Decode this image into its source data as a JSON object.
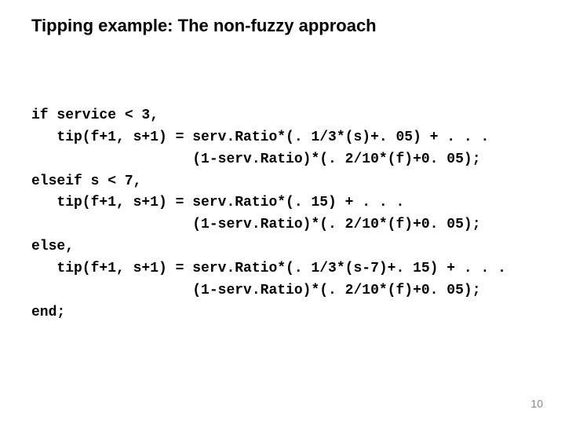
{
  "slide": {
    "title": "Tipping example:  The non-fuzzy approach",
    "code_lines": {
      "l1": "if service < 3,",
      "l2": "   tip(f+1, s+1) = serv.Ratio*(. 1/3*(s)+. 05) + . . .",
      "l3": "                   (1-serv.Ratio)*(. 2/10*(f)+0. 05);",
      "l4": "elseif s < 7,",
      "l5": "   tip(f+1, s+1) = serv.Ratio*(. 15) + . . .",
      "l6": "                   (1-serv.Ratio)*(. 2/10*(f)+0. 05);",
      "l7": "else,",
      "l8": "   tip(f+1, s+1) = serv.Ratio*(. 1/3*(s-7)+. 15) + . . .",
      "l9": "                   (1-serv.Ratio)*(. 2/10*(f)+0. 05);",
      "l10": "end;"
    },
    "page_number": "10"
  }
}
